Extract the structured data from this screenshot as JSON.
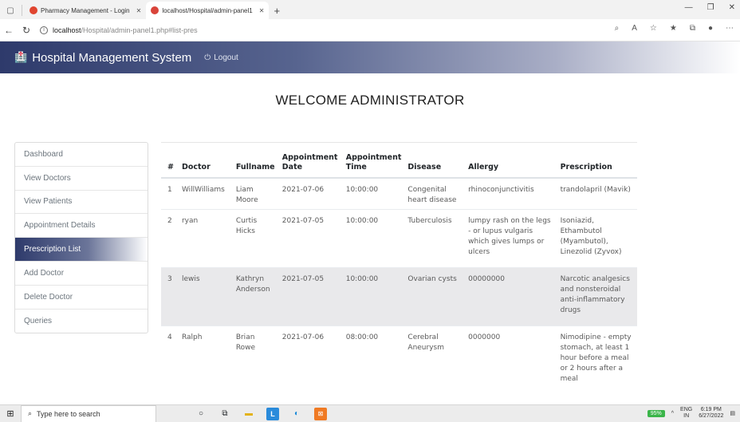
{
  "browser": {
    "tabs": [
      {
        "title": "Pharmacy Management - Login"
      },
      {
        "title": "localhost/Hospital/admin-panel1",
        "active": true
      }
    ],
    "url_host": "localhost",
    "url_path": "/Hospital/admin-panel1.php#list-pres"
  },
  "app": {
    "brand": "Hospital Management System",
    "logout_label": "Logout",
    "welcome": "WELCOME ADMINISTRATOR"
  },
  "sidebar": {
    "items": [
      {
        "label": "Dashboard"
      },
      {
        "label": "View Doctors"
      },
      {
        "label": "View Patients"
      },
      {
        "label": "Appointment Details"
      },
      {
        "label": "Prescription List",
        "active": true
      },
      {
        "label": "Add Doctor"
      },
      {
        "label": "Delete Doctor"
      },
      {
        "label": "Queries"
      }
    ]
  },
  "table": {
    "headers": [
      "#",
      "Doctor",
      "Fullname",
      "Appointment Date",
      "Appointment Time",
      "Disease",
      "Allergy",
      "Prescription"
    ],
    "rows": [
      [
        "1",
        "WillWilliams",
        "Liam Moore",
        "2021-07-06",
        "10:00:00",
        "Congenital heart disease",
        "rhinoconjunctivitis",
        "trandolapril (Mavik)"
      ],
      [
        "2",
        "ryan",
        "Curtis Hicks",
        "2021-07-05",
        "10:00:00",
        "Tuberculosis",
        "lumpy rash on the legs - or lupus vulgaris which gives lumps or ulcers",
        "Isoniazid, Ethambutol (Myambutol), Linezolid (Zyvox)"
      ],
      [
        "3",
        "lewis",
        "Kathryn Anderson",
        "2021-07-05",
        "10:00:00",
        "Ovarian cysts",
        "00000000",
        "Narcotic analgesics and nonsteroidal anti-inflammatory drugs"
      ],
      [
        "4",
        "Ralph",
        "Brian Rowe",
        "2021-07-06",
        "08:00:00",
        "Cerebral Aneurysm",
        "0000000",
        "Nimodipine - empty stomach, at least 1 hour before a meal or 2 hours after a meal"
      ]
    ]
  },
  "taskbar": {
    "search_placeholder": "Type here to search",
    "battery": "95%",
    "lang_top": "ENG",
    "lang_bottom": "IN",
    "time": "6:19 PM",
    "date": "6/27/2022"
  }
}
